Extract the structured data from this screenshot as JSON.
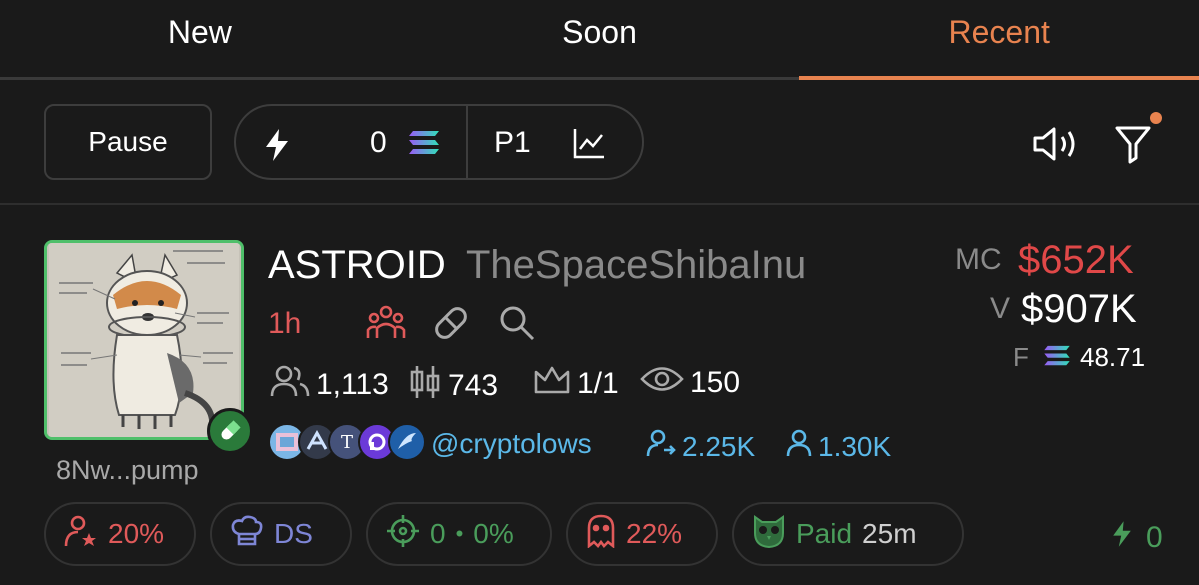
{
  "tabs": [
    {
      "label": "New",
      "active": false
    },
    {
      "label": "Soon",
      "active": false
    },
    {
      "label": "Recent",
      "active": true
    }
  ],
  "toolbar": {
    "pause_label": "Pause",
    "bolt_value": "0",
    "page_label": "P1",
    "has_filter_indicator": true
  },
  "token": {
    "name": "ASTROID",
    "subname": "TheSpaceShibaInu",
    "age": "1h",
    "address": "8Nw...pump",
    "holders": "1,113",
    "trades": "743",
    "top": "1/1",
    "views": "150",
    "twitter_handle": "@cryptolows",
    "followers_1": "2.25K",
    "followers_2": "1.30K",
    "mc_label": "MC",
    "mc_value": "$652K",
    "v_label": "V",
    "v_value": "$907K",
    "f_label": "F",
    "f_value": "48.71"
  },
  "chips": {
    "dev_pct": "20%",
    "ds_label": "DS",
    "snipers": "0",
    "snipers_sep": "•",
    "snipers_pct": "0%",
    "ghost_pct": "22%",
    "paid_label": "Paid",
    "paid_time": "25m",
    "bolt_count": "0"
  },
  "colors": {
    "accent": "#e8834f",
    "red": "#e04848",
    "green": "#4a9d5b",
    "blue": "#5bb8e8",
    "purple": "#7e86d6"
  }
}
